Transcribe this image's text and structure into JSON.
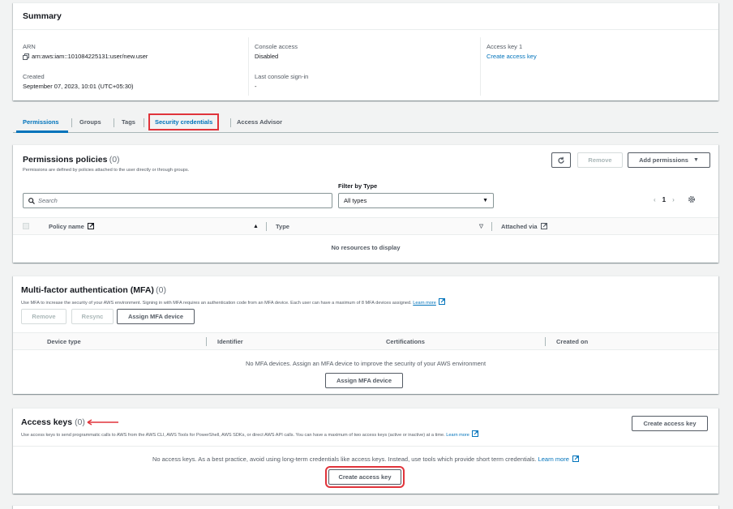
{
  "summary": {
    "title": "Summary",
    "arn_label": "ARN",
    "arn_value": "arn:aws:iam::101084225131:user/new.user",
    "created_label": "Created",
    "created_value": "September 07, 2023, 10:01 (UTC+05:30)",
    "console_access_label": "Console access",
    "console_access_value": "Disabled",
    "last_signin_label": "Last console sign-in",
    "last_signin_value": "-",
    "access_key_label": "Access key 1",
    "access_key_link": "Create access key"
  },
  "tabs": [
    {
      "label": "Permissions"
    },
    {
      "label": "Groups"
    },
    {
      "label": "Tags"
    },
    {
      "label": "Security credentials"
    },
    {
      "label": "Access Advisor"
    }
  ],
  "permissions": {
    "title": "Permissions policies",
    "count": "(0)",
    "description": "Permissions are defined by policies attached to the user directly or through groups.",
    "remove_label": "Remove",
    "add_label": "Add permissions",
    "filter_label": "Filter by Type",
    "search_placeholder": "Search",
    "filter_value": "All types",
    "page": "1",
    "col_policy": "Policy name",
    "col_type": "Type",
    "col_attached": "Attached via",
    "empty": "No resources to display"
  },
  "mfa": {
    "title": "Multi-factor authentication (MFA)",
    "count": "(0)",
    "description": "Use MFA to increase the security of your AWS environment. Signing in with MFA requires an authentication code from an MFA device. Each user can have a maximum of 8 MFA devices assigned.",
    "learn_more": "Learn more",
    "remove_label": "Remove",
    "resync_label": "Resync",
    "assign_label": "Assign MFA device",
    "col_device": "Device type",
    "col_identifier": "Identifier",
    "col_certifications": "Certifications",
    "col_created": "Created on",
    "empty": "No MFA devices. Assign an MFA device to improve the security of your AWS environment",
    "assign_center_label": "Assign MFA device"
  },
  "access_keys": {
    "title": "Access keys",
    "count": "(0)",
    "description": "Use access keys to send programmatic calls to AWS from the AWS CLI, AWS Tools for PowerShell, AWS SDKs, or direct AWS API calls. You can have a maximum of two access keys (active or inactive) at a time.",
    "learn_more": "Learn more",
    "create_label": "Create access key",
    "empty": "No access keys. As a best practice, avoid using long-term credentials like access keys. Instead, use tools which provide short term credentials.",
    "empty_learn_more": "Learn more",
    "create_center_label": "Create access key"
  },
  "colors": {
    "accent": "#0073bb",
    "highlight": "#e0343b",
    "background": "#f2f3f3"
  }
}
